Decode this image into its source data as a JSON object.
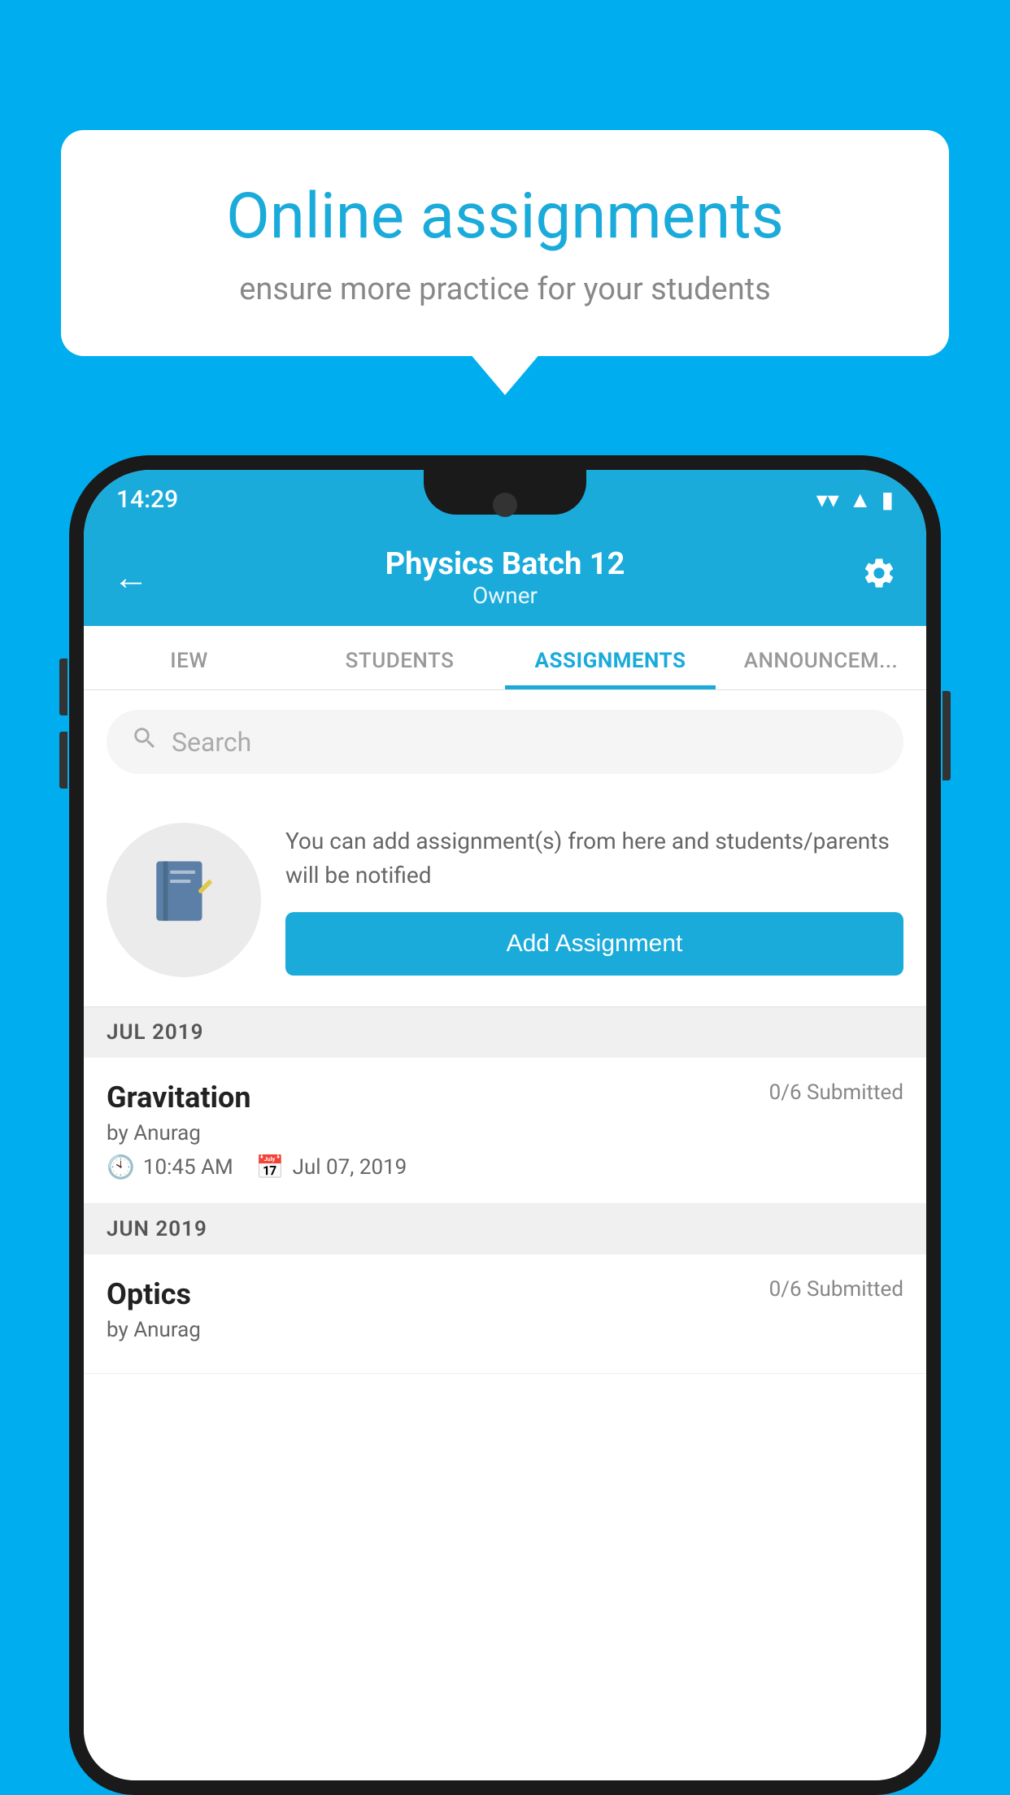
{
  "background_color": "#00AEEF",
  "speech_bubble": {
    "title": "Online assignments",
    "subtitle": "ensure more practice for your students"
  },
  "status_bar": {
    "time": "14:29",
    "wifi": "▼",
    "signal": "▲",
    "battery": "▮"
  },
  "header": {
    "title": "Physics Batch 12",
    "subtitle": "Owner",
    "back_label": "←",
    "settings_label": "⚙"
  },
  "tabs": [
    {
      "label": "IEW",
      "active": false
    },
    {
      "label": "STUDENTS",
      "active": false
    },
    {
      "label": "ASSIGNMENTS",
      "active": true
    },
    {
      "label": "ANNOUNCEMENTS",
      "active": false
    }
  ],
  "search": {
    "placeholder": "Search"
  },
  "promo": {
    "text": "You can add assignment(s) from here and students/parents will be notified",
    "button_label": "Add Assignment"
  },
  "sections": [
    {
      "header": "JUL 2019",
      "assignments": [
        {
          "name": "Gravitation",
          "submitted": "0/6 Submitted",
          "by": "by Anurag",
          "time": "10:45 AM",
          "date": "Jul 07, 2019"
        }
      ]
    },
    {
      "header": "JUN 2019",
      "assignments": [
        {
          "name": "Optics",
          "submitted": "0/6 Submitted",
          "by": "by Anurag",
          "time": "",
          "date": ""
        }
      ]
    }
  ]
}
